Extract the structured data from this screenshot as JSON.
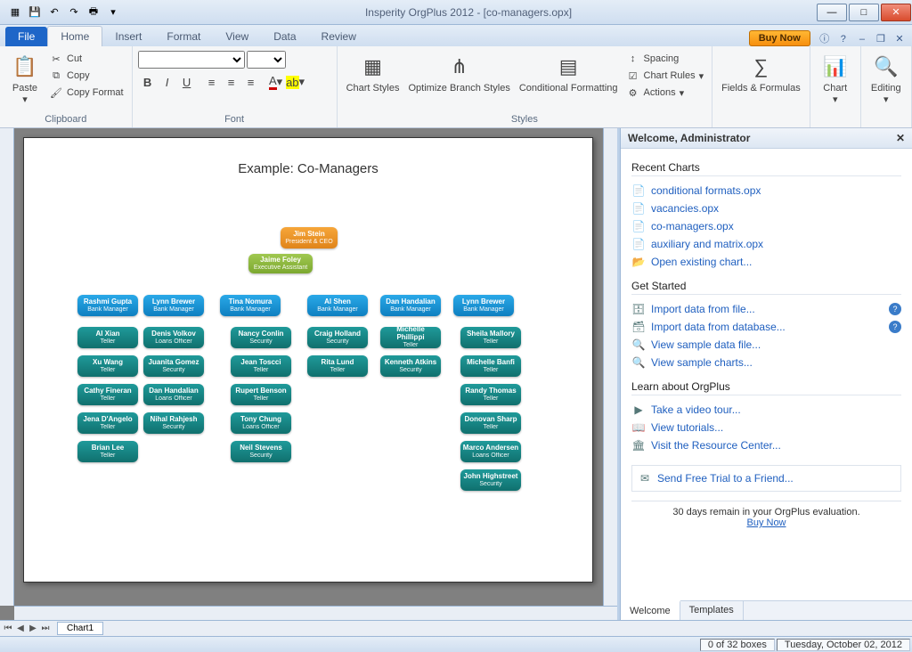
{
  "titlebar": {
    "title": "Insperity OrgPlus 2012 - [co-managers.opx]"
  },
  "qat": [
    "app",
    "save",
    "undo",
    "redo",
    "print"
  ],
  "tabs": {
    "file": "File",
    "list": [
      "Home",
      "Insert",
      "Format",
      "View",
      "Data",
      "Review"
    ],
    "active": 0,
    "buy": "Buy Now"
  },
  "ribbon": {
    "clipboard": {
      "label": "Clipboard",
      "paste": "Paste",
      "cut": "Cut",
      "copy": "Copy",
      "copyfmt": "Copy Format"
    },
    "font": {
      "label": "Font"
    },
    "styles": {
      "label": "Styles",
      "chart": "Chart Styles",
      "branch": "Optimize Branch Styles",
      "cond": "Conditional Formatting",
      "spacing": "Spacing",
      "rules": "Chart Rules",
      "actions": "Actions"
    },
    "fields": {
      "label": "Fields & Formulas"
    },
    "chartg": {
      "label": "Chart"
    },
    "editing": {
      "label": "Editing"
    }
  },
  "chart_data": {
    "type": "org-hierarchy",
    "title": "Example: Co-Managers",
    "root": {
      "name": "Jim Stein",
      "title": "President & CEO",
      "style": "orange"
    },
    "assistant": {
      "name": "Jaime Foley",
      "title": "Executive Assistant",
      "style": "green"
    },
    "managers": [
      {
        "name": "Rashmi Gupta",
        "title": "Bank Manager",
        "reports": [
          {
            "name": "Al Xian",
            "title": "Teller"
          },
          {
            "name": "Xu Wang",
            "title": "Teller"
          },
          {
            "name": "Cathy Fineran",
            "title": "Teller"
          },
          {
            "name": "Jena D'Angelo",
            "title": "Teller"
          },
          {
            "name": "Brian Lee",
            "title": "Teller"
          }
        ],
        "shared": [
          {
            "name": "Denis Volkov",
            "title": "Loans Officer"
          },
          {
            "name": "Juanita Gomez",
            "title": "Security"
          },
          {
            "name": "Dan Handalian",
            "title": "Loans Officer"
          },
          {
            "name": "Nihal Rahjesh",
            "title": "Security"
          }
        ]
      },
      {
        "name": "Lynn Brewer",
        "title": "Bank Manager",
        "shares_with": 0
      },
      {
        "name": "Tina Nomura",
        "title": "Bank Manager",
        "reports": [
          {
            "name": "Nancy Conlin",
            "title": "Security"
          },
          {
            "name": "Jean Toscci",
            "title": "Teller"
          },
          {
            "name": "Rupert Benson",
            "title": "Teller"
          },
          {
            "name": "Tony Chung",
            "title": "Loans Officer"
          },
          {
            "name": "Neil Stevens",
            "title": "Security"
          }
        ]
      },
      {
        "name": "Al Shen",
        "title": "Bank Manager",
        "reports": [
          {
            "name": "Craig Holland",
            "title": "Security"
          },
          {
            "name": "Rita Lund",
            "title": "Teller"
          }
        ]
      },
      {
        "name": "Dan Handalian",
        "title": "Bank Manager",
        "reports": [
          {
            "name": "Michelle Phillippi",
            "title": "Teller"
          },
          {
            "name": "Kenneth Atkins",
            "title": "Security"
          }
        ]
      },
      {
        "name": "Lynn Brewer",
        "title": "Bank Manager",
        "reports": [
          {
            "name": "Sheila Mallory",
            "title": "Teller"
          },
          {
            "name": "Michelle Banfi",
            "title": "Teller"
          },
          {
            "name": "Randy Thomas",
            "title": "Teller"
          },
          {
            "name": "Donovan Sharp",
            "title": "Teller"
          },
          {
            "name": "Marco Andersen",
            "title": "Loans Officer"
          },
          {
            "name": "John Highstreet",
            "title": "Security"
          }
        ]
      }
    ]
  },
  "panel": {
    "header": "Welcome, Administrator",
    "recent_h": "Recent Charts",
    "recent": [
      "conditional formats.opx",
      "vacancies.opx",
      "co-managers.opx",
      "auxiliary and matrix.opx"
    ],
    "open": "Open existing chart...",
    "started_h": "Get Started",
    "started": [
      "Import data from file...",
      "Import data from database...",
      "View sample data file...",
      "View sample charts..."
    ],
    "learn_h": "Learn about OrgPlus",
    "learn": [
      "Take a video tour...",
      "View tutorials...",
      "Visit the Resource Center..."
    ],
    "send": "Send Free Trial to a Friend...",
    "eval1": "30 days remain in your OrgPlus evaluation.",
    "eval2": "Buy Now",
    "tabs": [
      "Welcome",
      "Templates"
    ]
  },
  "sheet": {
    "tab": "Chart1"
  },
  "status": {
    "boxes": "0 of 32 boxes",
    "date": "Tuesday, October 02, 2012"
  }
}
